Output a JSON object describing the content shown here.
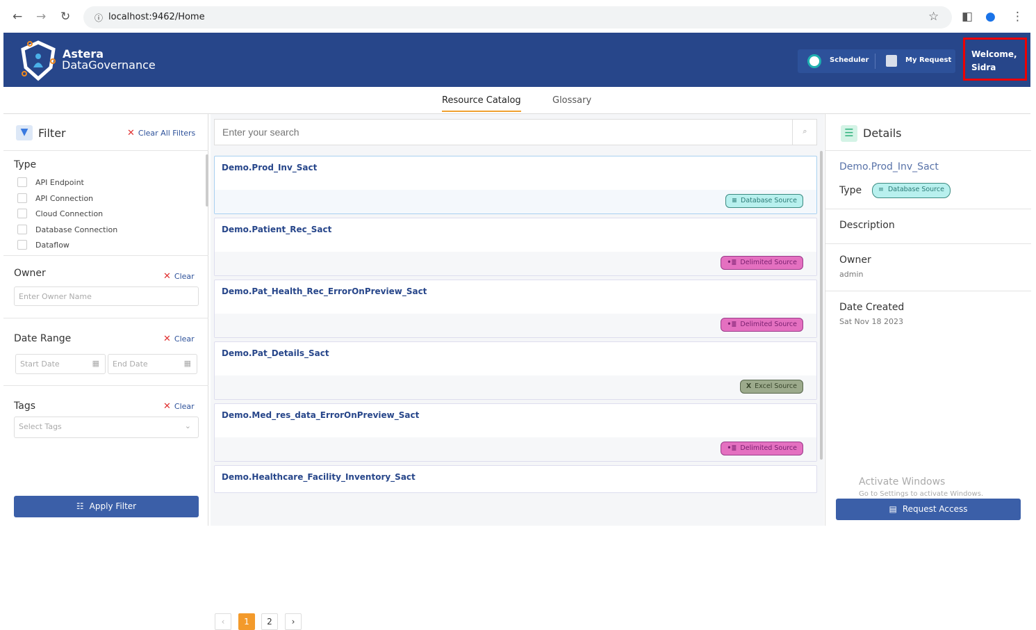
{
  "browser": {
    "url": "localhost:9462/Home"
  },
  "header": {
    "brand_line1": "Astera",
    "brand_line2": "DataGovernance",
    "scheduler": "Scheduler",
    "my_request": "My Request",
    "welcome": "Welcome, Sidra"
  },
  "tabs": [
    {
      "label": "Resource Catalog",
      "active": true
    },
    {
      "label": "Glossary",
      "active": false
    }
  ],
  "filter": {
    "title": "Filter",
    "clear_all": "Clear All Filters",
    "type_label": "Type",
    "types": [
      "API Endpoint",
      "API Connection",
      "Cloud Connection",
      "Database Connection",
      "Dataflow"
    ],
    "owner_label": "Owner",
    "owner_clear": "Clear",
    "owner_placeholder": "Enter Owner Name",
    "date_label": "Date Range",
    "date_clear": "Clear",
    "start_placeholder": "Start Date",
    "end_placeholder": "End Date",
    "tags_label": "Tags",
    "tags_clear": "Clear",
    "tags_placeholder": "Select Tags",
    "apply": "Apply Filter"
  },
  "search": {
    "placeholder": "Enter your search"
  },
  "results": [
    {
      "name": "Demo.Prod_Inv_Sact",
      "type": "Database Source",
      "kind": "db"
    },
    {
      "name": "Demo.Patient_Rec_Sact",
      "type": "Delimited Source",
      "kind": "dl"
    },
    {
      "name": "Demo.Pat_Health_Rec_ErrorOnPreview_Sact",
      "type": "Delimited Source",
      "kind": "dl"
    },
    {
      "name": "Demo.Pat_Details_Sact",
      "type": "Excel Source",
      "kind": "xl"
    },
    {
      "name": "Demo.Med_res_data_ErrorOnPreview_Sact",
      "type": "Delimited Source",
      "kind": "dl"
    },
    {
      "name": "Demo.Healthcare_Facility_Inventory_Sact",
      "type": "",
      "kind": ""
    }
  ],
  "pagination": {
    "pages": [
      "1",
      "2"
    ],
    "current": "1"
  },
  "details": {
    "title": "Details",
    "name": "Demo.Prod_Inv_Sact",
    "type_label": "Type",
    "type": "Database Source",
    "description_label": "Description",
    "owner_label": "Owner",
    "owner": "admin",
    "date_label": "Date Created",
    "date": "Sat Nov 18 2023",
    "request": "Request Access"
  },
  "watermark": {
    "line1": "Activate Windows",
    "line2": "Go to Settings to activate Windows."
  }
}
